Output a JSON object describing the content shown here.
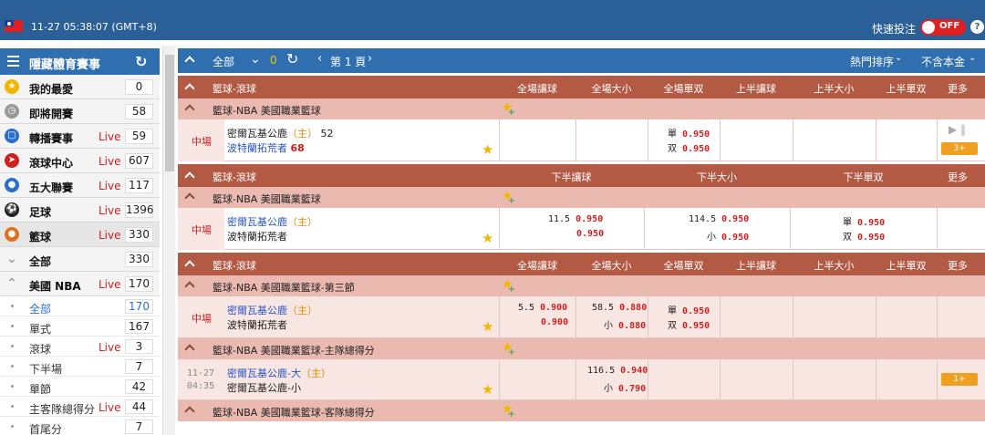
{
  "topbar": {
    "datetime": "11-27 05:38:07 (GMT+8)",
    "quick_bet": "快速投注",
    "toggle": "OFF",
    "help": "?"
  },
  "sidebar": {
    "title": "隱藏體育賽事",
    "items": [
      {
        "name": "我的最愛",
        "live": "",
        "count": "0",
        "icon": "star-icon"
      },
      {
        "name": "即將開賽",
        "live": "",
        "count": "58",
        "icon": "clock-icon"
      },
      {
        "name": "轉播賽事",
        "live": "Live",
        "count": "59",
        "icon": "tv-icon"
      },
      {
        "name": "滾球中心",
        "live": "Live",
        "count": "607",
        "icon": "runner-icon"
      },
      {
        "name": "五大聯賽",
        "live": "Live",
        "count": "117",
        "icon": "soccer-ball-icon"
      },
      {
        "name": "足球",
        "live": "Live",
        "count": "1396",
        "icon": "football-icon"
      },
      {
        "name": "籃球",
        "live": "Live",
        "count": "330",
        "icon": "basketball-icon"
      },
      {
        "name": "全部",
        "live": "",
        "count": "330",
        "icon": "chevron-down-icon"
      },
      {
        "name": "美國 NBA",
        "live": "Live",
        "count": "170",
        "icon": "chevron-up-icon"
      }
    ],
    "subitems": [
      {
        "name": "全部",
        "live": "",
        "count": "170"
      },
      {
        "name": "單式",
        "live": "",
        "count": "167"
      },
      {
        "name": "滾球",
        "live": "Live",
        "count": "3"
      },
      {
        "name": "下半場",
        "live": "",
        "count": "7"
      },
      {
        "name": "單節",
        "live": "",
        "count": "42"
      },
      {
        "name": "主客隊總得分",
        "live": "Live",
        "count": "44"
      },
      {
        "name": "首尾分",
        "live": "",
        "count": "7"
      }
    ]
  },
  "toolbar": {
    "all": "全部",
    "count": "0",
    "page": "第 1 頁",
    "sort": "熱門排序",
    "principal": "不含本金"
  },
  "sections": [
    {
      "header": {
        "title": "籃球-滾球",
        "cols": [
          "全場讓球",
          "全場大小",
          "全場單双",
          "上半讓球",
          "上半大小",
          "上半單双",
          "更多"
        ]
      },
      "league": "籃球-NBA 美國職業籃球",
      "match": {
        "status": "中場",
        "home": "密爾瓦基公鹿",
        "home_tag": "（主）",
        "home_score": "52",
        "away": "波特蘭拓荒者",
        "away_score": "68",
        "odd_lbl": "單",
        "odd_val": "0.950",
        "even_lbl": "双",
        "even_val": "0.950",
        "more": "3+"
      }
    },
    {
      "header": {
        "title": "籃球-滾球",
        "cols": [
          "下半讓球",
          "下半大小",
          "下半單双",
          "更多"
        ]
      },
      "league": "籃球-NBA 美國職業籃球",
      "match": {
        "status": "中場",
        "home": "密爾瓦基公鹿",
        "home_tag": "（主）",
        "away": "波特蘭拓荒者",
        "hdp": "11.5",
        "hdp_home": "0.950",
        "hdp_away": "0.950",
        "ou": "114.5",
        "ou_over": "0.950",
        "ou_under_lbl": "小",
        "ou_under": "0.950",
        "odd_lbl": "單",
        "odd_val": "0.950",
        "even_lbl": "双",
        "even_val": "0.950"
      }
    },
    {
      "header": {
        "title": "籃球-滾球",
        "cols": [
          "全場讓球",
          "全場大小",
          "全場單双",
          "上半讓球",
          "上半大小",
          "上半單双",
          "更多"
        ]
      },
      "league": "籃球-NBA 美國職業籃球-第三節",
      "match": {
        "status": "中場",
        "home": "密爾瓦基公鹿",
        "home_tag": "（主）",
        "away": "波特蘭拓荒者",
        "hdp": "5.5",
        "hdp_home": "0.900",
        "hdp_away": "0.900",
        "ou": "58.5",
        "ou_over": "0.880",
        "ou_under_lbl": "小",
        "ou_under": "0.880",
        "odd_lbl": "單",
        "odd_val": "0.950",
        "even_lbl": "双",
        "even_val": "0.950"
      },
      "league2": "籃球-NBA 美國職業籃球-主隊總得分",
      "match2": {
        "date": "11-27",
        "time": "04:35",
        "home": "密爾瓦基公鹿-大",
        "home_tag": "（主）",
        "away": "密爾瓦基公鹿-小",
        "ou": "116.5",
        "ou_over": "0.940",
        "ou_under_lbl": "小",
        "ou_under": "0.790",
        "more": "1+"
      },
      "league3": "籃球-NBA 美國職業籃球-客隊總得分"
    }
  ]
}
